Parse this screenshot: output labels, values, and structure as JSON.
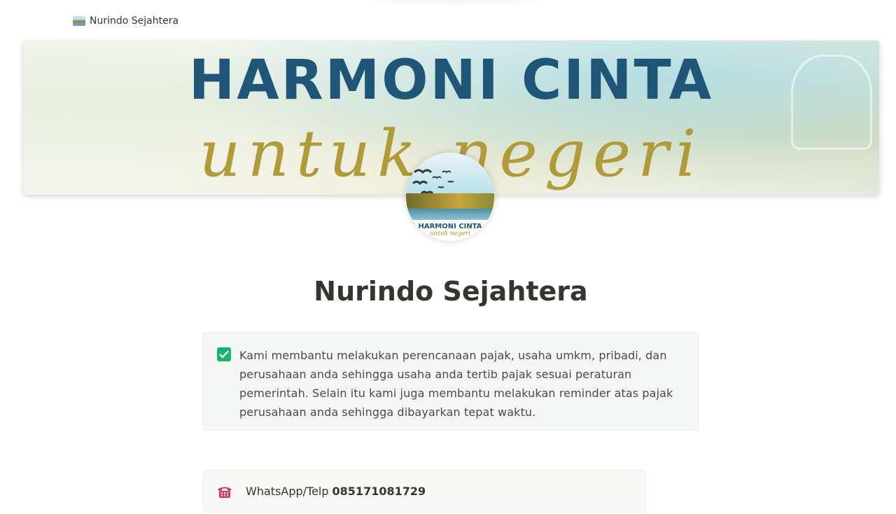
{
  "breadcrumb": {
    "title": "Nurindo Sejahtera",
    "icon": "landscape-thumbnail-icon"
  },
  "cover": {
    "title": "HARMONI CINTA",
    "script": "untuk negeri",
    "title_color": "#1f5677",
    "script_color": "#b19a39"
  },
  "avatar": {
    "title": "HARMONI CINTA",
    "script": "untuk negeri"
  },
  "page": {
    "title": "Nurindo Sejahtera"
  },
  "callout": {
    "icon": "check-icon",
    "icon_color": "#17b46b",
    "text": "Kami membantu melakukan perencanaan pajak, usaha umkm, pribadi, dan perusahaan anda sehingga usaha anda tertib pajak sesuai peraturan pemerintah. Selain itu kami juga membantu melakukan reminder atas pajak perusahaan anda sehingga dibayarkan tepat waktu."
  },
  "contact": {
    "icon": "telephone-icon",
    "label": "WhatsApp/Telp",
    "number": "085171081729"
  }
}
